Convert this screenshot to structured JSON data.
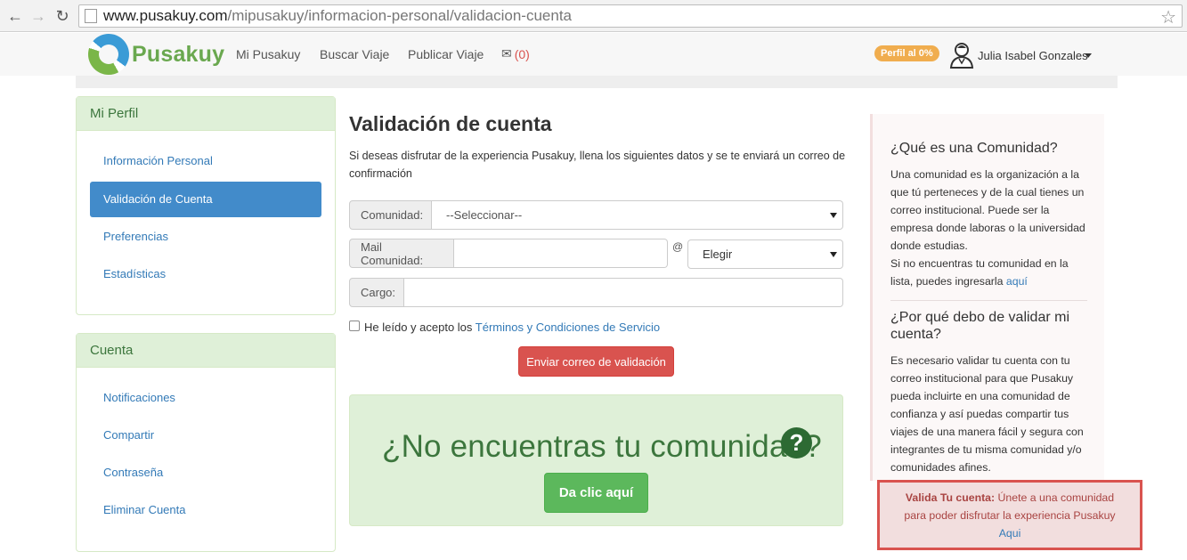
{
  "browser": {
    "url_host": "www.pusakuy.com",
    "url_path": "/mipusakuy/informacion-personal/validacion-cuenta"
  },
  "navbar": {
    "logo_text": "Pusakuy",
    "links": [
      "Mi Pusakuy",
      "Buscar Viaje",
      "Publicar Viaje"
    ],
    "mail_count": "(0)",
    "profile_badge": "Perfil al 0%",
    "user_name": "Julia Isabel Gonzales"
  },
  "sidebar_profile": {
    "title": "Mi Perfil",
    "items": [
      "Información Personal",
      "Validación de Cuenta",
      "Preferencias",
      "Estadísticas"
    ]
  },
  "sidebar_account": {
    "title": "Cuenta",
    "items": [
      "Notificaciones",
      "Compartir",
      "Contraseña",
      "Eliminar Cuenta"
    ]
  },
  "main": {
    "title": "Validación de cuenta",
    "description": "Si deseas disfrutar de la experiencia Pusakuy, llena los siguientes datos y se te enviará un correo de confirmación",
    "comunidad_label": "Comunidad:",
    "comunidad_value": "--Seleccionar--",
    "mail_label": "Mail Comunidad:",
    "mail_value": "",
    "at": "@",
    "domain_value": "Elegir",
    "cargo_label": "Cargo:",
    "cargo_value": "",
    "terms_prefix": "He leído y acepto los",
    "terms_link": "Términos y Condiciones de Servicio",
    "submit_label": "Enviar correo de validación",
    "community_heading": "¿No encuentras tu comunidad?",
    "community_button": "Da clic aquí"
  },
  "help": {
    "q1": "¿Qué es una Comunidad?",
    "a1": "Una comunidad es la organización a la que tú perteneces y de la cual tienes un correo institucional. Puede ser la empresa donde laboras o la universidad donde estudias.",
    "a1b": "Si no encuentras tu comunidad en la lista, puedes ingresarla",
    "a1b_link": "aquí",
    "q2": "¿Por qué debo de validar mi cuenta?",
    "a2": "Es necesario validar tu cuenta con tu correo institucional para que Pusakuy pueda incluirte en una comunidad de confianza y así puedas compartir tus viajes de una manera fácil y segura con integrantes de tu misma comunidad y/o comunidades afines."
  },
  "alert": {
    "strong": "Valida Tu cuenta:",
    "text": "Únete a una comunidad para poder disfrutar la experiencia Pusakuy",
    "link": "Aqui"
  },
  "colors": {
    "primary": "#428bca",
    "danger": "#d9534f",
    "success": "#5cb85c",
    "brand_green": "#6aa84f"
  }
}
